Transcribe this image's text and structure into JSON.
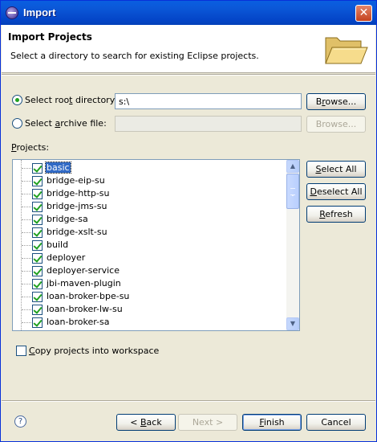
{
  "window": {
    "title": "Import",
    "close_glyph": "✕"
  },
  "banner": {
    "title": "Import Projects",
    "description": "Select a directory to search for existing Eclipse projects."
  },
  "root_directory": {
    "label_pre": "Select roo",
    "label_mnemonic": "t",
    "label_post": " directory:",
    "selected": true,
    "value": "s:\\",
    "browse_pre": "B",
    "browse_mnemonic": "r",
    "browse_post": "owse..."
  },
  "archive_file": {
    "label_pre": "Select ",
    "label_mnemonic": "a",
    "label_post": "rchive file:",
    "selected": false,
    "value": "",
    "browse_label": "Browse..."
  },
  "projects": {
    "label_pre": "",
    "label_mnemonic": "P",
    "label_post": "rojects:",
    "items": [
      {
        "name": "basic",
        "checked": true,
        "selected": true
      },
      {
        "name": "bridge-eip-su",
        "checked": true
      },
      {
        "name": "bridge-http-su",
        "checked": true
      },
      {
        "name": "bridge-jms-su",
        "checked": true
      },
      {
        "name": "bridge-sa",
        "checked": true
      },
      {
        "name": "bridge-xslt-su",
        "checked": true
      },
      {
        "name": "build",
        "checked": true
      },
      {
        "name": "deployer",
        "checked": true
      },
      {
        "name": "deployer-service",
        "checked": true
      },
      {
        "name": "jbi-maven-plugin",
        "checked": true
      },
      {
        "name": "loan-broker-bpe-su",
        "checked": true
      },
      {
        "name": "loan-broker-lw-su",
        "checked": true
      },
      {
        "name": "loan-broker-sa",
        "checked": true
      }
    ]
  },
  "side_buttons": {
    "select_all_pre": "",
    "select_all_mnemonic": "S",
    "select_all_post": "elect All",
    "deselect_all_pre": "",
    "deselect_all_mnemonic": "D",
    "deselect_all_post": "eselect All",
    "refresh_pre": "",
    "refresh_mnemonic": "R",
    "refresh_post": "efresh"
  },
  "copy_projects": {
    "label_pre": "",
    "label_mnemonic": "C",
    "label_post": "opy projects into workspace",
    "checked": false
  },
  "footer": {
    "help_glyph": "?",
    "back_pre": "< ",
    "back_mnemonic": "B",
    "back_post": "ack",
    "next_label": "Next >",
    "finish_pre": "",
    "finish_mnemonic": "F",
    "finish_post": "inish",
    "cancel_label": "Cancel"
  },
  "icons": {
    "title_icon": "eclipse-icon",
    "banner_icon": "open-folder-icon",
    "help_icon": "help-icon"
  },
  "colors": {
    "titlebar": "#0445c7",
    "selection": "#316ac5",
    "check": "#21a121"
  }
}
